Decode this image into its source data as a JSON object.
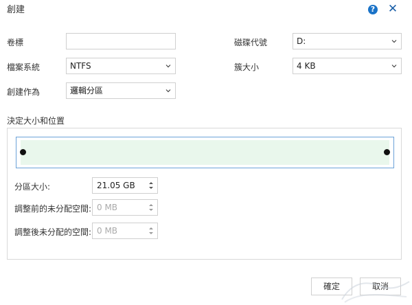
{
  "dialog": {
    "title": "創建",
    "help_glyph": "?",
    "close_glyph": "✕"
  },
  "form": {
    "volume_label": {
      "label": "卷標",
      "value": ""
    },
    "drive_letter": {
      "label": "磁碟代號",
      "value": "D:"
    },
    "file_system": {
      "label": "檔案系統",
      "value": "NTFS"
    },
    "cluster_size": {
      "label": "簇大小",
      "value": "4 KB"
    },
    "create_as": {
      "label": "創建作為",
      "value": "邏輯分區"
    }
  },
  "size_position": {
    "title": "決定大小和位置",
    "slider_fraction": 1.0,
    "partition_size": {
      "label": "分區大小:",
      "value": "21.05 GB"
    },
    "unalloc_before": {
      "label": "調整前的未分配空間:",
      "value": "0 MB"
    },
    "unalloc_after": {
      "label": "調整後未分配的空間:",
      "value": "0 MB"
    }
  },
  "buttons": {
    "ok": "確定",
    "cancel": "取消"
  },
  "colors": {
    "accent": "#1a73c8",
    "slider_border": "#6ba1d8",
    "slider_fill": "#e9f7ec"
  }
}
